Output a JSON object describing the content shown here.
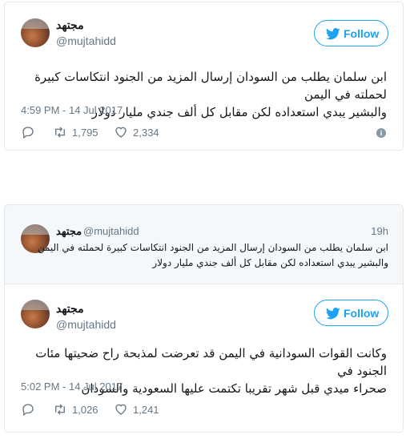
{
  "tweet1": {
    "display_name": "مجتهد",
    "handle": "@mujtahidd",
    "follow_label": "Follow",
    "text_line1": "ابن سلمان يطلب من السودان إرسال المزيد من الجنود انتكاسات كبيرة لحملته في اليمن",
    "text_line2": "والبشير يبدي استعداده لكن مقابل كل ألف جندي مليار دولار",
    "timestamp": "4:59 PM - 14 Jul 2017",
    "retweets": "1,795",
    "likes": "2,334"
  },
  "quoted": {
    "display_name": "مجتهد",
    "handle": "@mujtahidd",
    "age": "19h",
    "text_line1": "ابن سلمان يطلب من السودان إرسال المزيد من الجنود انتكاسات كبيرة لحملته في اليمن",
    "text_line2": "والبشير يبدي استعداده لكن مقابل كل ألف جندي مليار دولار"
  },
  "tweet2": {
    "display_name": "مجتهد",
    "handle": "@mujtahidd",
    "follow_label": "Follow",
    "text_line1": "وكانت القوات السودانية في اليمن قد تعرضت لمذبحة راح ضحيتها مئات الجنود في",
    "text_line2": "صحراء ميدي قبل شهر تقريبا تكتمت عليها السعودية والسودان",
    "timestamp": "5:02 PM - 14 Jul 2017",
    "retweets": "1,026",
    "likes": "1,241"
  },
  "colors": {
    "accent": "#1da1f2",
    "muted": "#657786",
    "border": "#e1e8ed"
  },
  "icons": [
    "reply-icon",
    "retweet-icon",
    "like-icon",
    "info-icon",
    "twitter-bird-icon"
  ]
}
